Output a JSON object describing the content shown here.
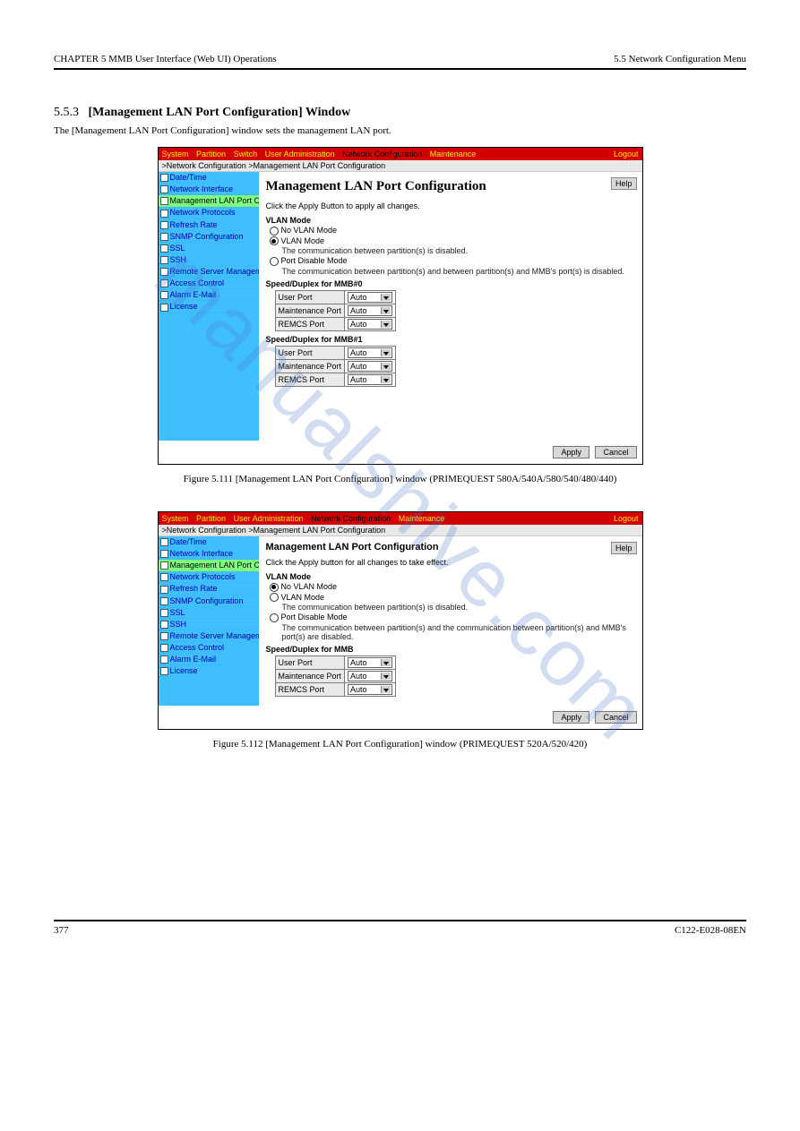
{
  "header": {
    "left": "CHAPTER 5 MMB User Interface (Web UI) Operations",
    "right": "5.5 Network Configuration Menu"
  },
  "footer": {
    "left": "377",
    "right": "C122-E028-08EN"
  },
  "section": {
    "number": "5.5.3",
    "title": "[Management LAN Port Configuration] Window",
    "text": "The [Management LAN Port Configuration] window sets the management LAN port."
  },
  "fig1_caption": "Figure 5.111 [Management LAN Port Configuration] window (PRIMEQUEST 580A/540A/580/540/480/440)",
  "fig2_caption": "Figure 5.112 [Management LAN Port Configuration] window (PRIMEQUEST 520A/520/420)",
  "watermark": "manualshive.com",
  "menus1": [
    "System",
    "Partition",
    "Switch",
    "User Administration",
    "Network Configuration",
    "Maintenance"
  ],
  "menus2": [
    "System",
    "Partition",
    "User Administration",
    "Network Configuration",
    "Maintenance"
  ],
  "logout": "Logout",
  "crumb": ">Network Configuration >Management LAN Port Configuration",
  "nav": [
    "Date/Time",
    "Network Interface",
    "Management LAN Port Configuration",
    "Network Protocols",
    "Refresh Rate",
    "SNMP Configuration",
    "SSL",
    "SSH",
    "Remote Server Management",
    "Access Control",
    "Alarm E-Mail",
    "License"
  ],
  "nav2_label": "Management LAN Port Configura",
  "content": {
    "heading": "Management LAN Port Configuration",
    "help": "Help",
    "apply_hint1": "Click the Apply Button to apply all changes.",
    "apply_hint2": "Click the Apply button for all changes to take effect.",
    "vlan_label": "VLAN Mode",
    "r_no": "No VLAN Mode",
    "r_vlan": "VLAN Mode",
    "r_vlan_desc": "The communication between partition(s) is disabled.",
    "r_port": "Port Disable Mode",
    "r_port_desc1": "The communication between partition(s) and between partition(s) and MMB's port(s) is disabled.",
    "r_port_desc2": "The communication between partition(s) and the communication between partition(s) and MMB's port(s) are disabled.",
    "spdx0": "Speed/Duplex for MMB#0",
    "spdx1": "Speed/Duplex for MMB#1",
    "spdx": "Speed/Duplex for MMB",
    "rows": [
      {
        "label": "User Port",
        "value": "Auto"
      },
      {
        "label": "Maintenance Port",
        "value": "Auto"
      },
      {
        "label": "REMCS Port",
        "value": "Auto"
      }
    ],
    "apply": "Apply",
    "cancel": "Cancel"
  }
}
